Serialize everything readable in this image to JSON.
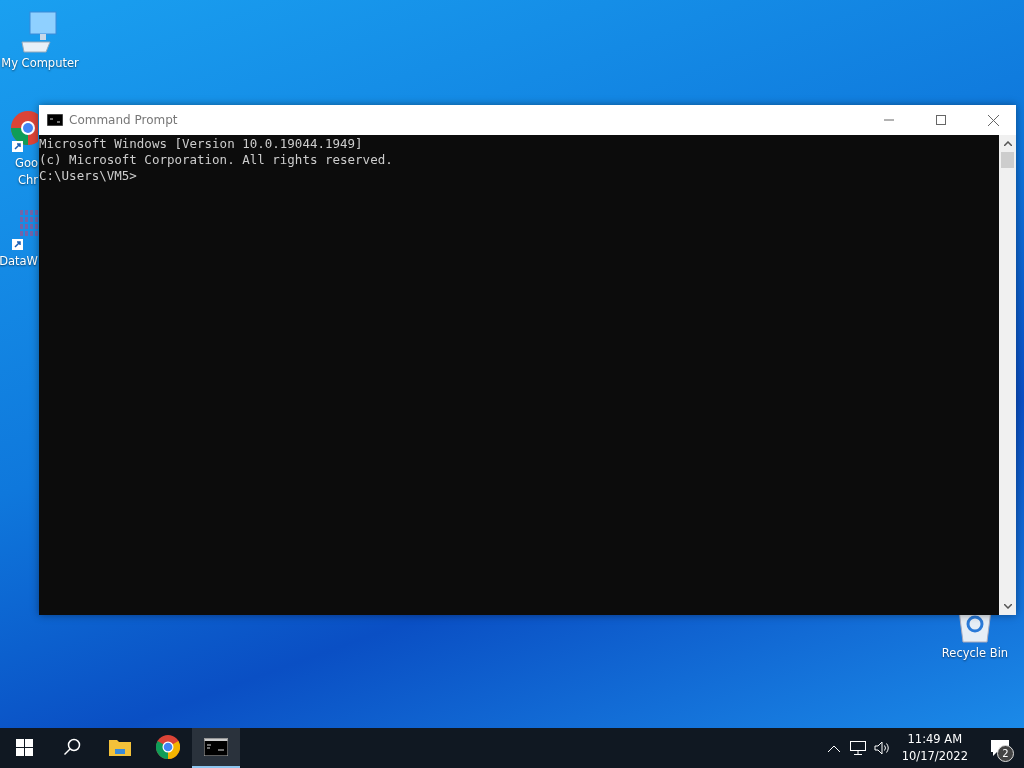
{
  "desktop_icons": [
    {
      "kind": "computer",
      "label": [
        "My Computer"
      ]
    },
    {
      "kind": "chrome",
      "label": [
        "Goo",
        "Chr"
      ]
    },
    {
      "kind": "datawin",
      "label": [
        "DataW"
      ]
    },
    {
      "kind": "recycle",
      "label": [
        "Recycle Bin"
      ]
    }
  ],
  "window": {
    "title": "Command Prompt",
    "lines": [
      "Microsoft Windows [Version 10.0.19044.1949]",
      "(c) Microsoft Corporation. All rights reserved.",
      "C:\\Users\\VM5>"
    ]
  },
  "taskbar": {
    "apps": [
      {
        "kind": "start",
        "selected": false
      },
      {
        "kind": "search",
        "selected": false
      },
      {
        "kind": "explorer",
        "selected": false
      },
      {
        "kind": "chrome",
        "selected": false
      },
      {
        "kind": "cmd",
        "selected": true
      }
    ],
    "tray": {
      "time": "11:49 AM",
      "date": "10/17/2022",
      "notifications": "2"
    }
  }
}
